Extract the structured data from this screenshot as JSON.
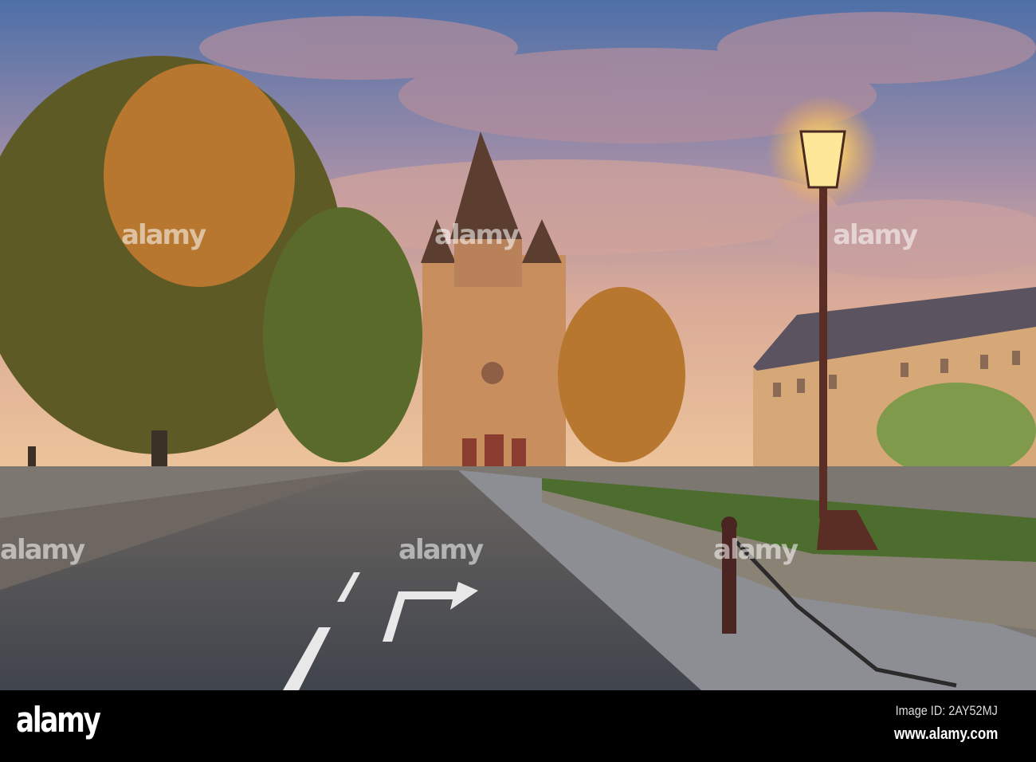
{
  "photo": {
    "subject": "church street scene at sunset",
    "colors": {
      "sky_top": "#4d6fa8",
      "cloud": "#c9a1a0",
      "glow": "#f3c98a",
      "tree": "#6b6a2a",
      "stone": "#c98e5e",
      "asphalt": "#4b4f57"
    }
  },
  "watermark": {
    "text": "alamy"
  },
  "footer": {
    "logo": "alamy",
    "image_id": "Image ID: 2AY52MJ",
    "url": "www.alamy.com"
  }
}
